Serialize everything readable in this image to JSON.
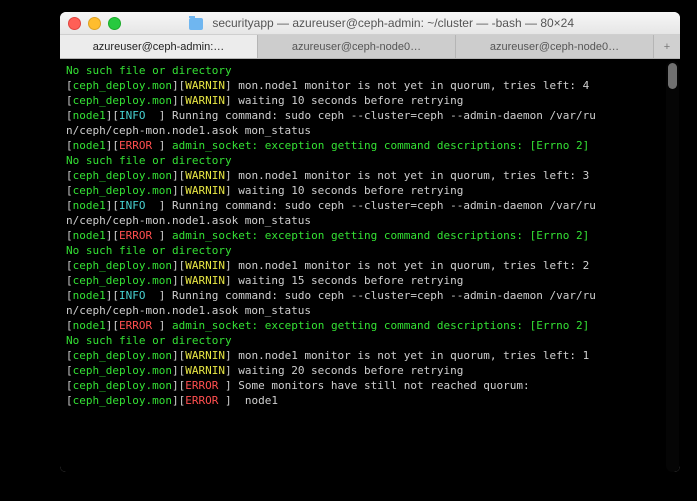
{
  "window": {
    "title": "securityapp — azureuser@ceph-admin: ~/cluster — -bash — 80×24"
  },
  "tabs": {
    "items": [
      {
        "label": "azureuser@ceph-admin:…",
        "active": true
      },
      {
        "label": "azureuser@ceph-node0…",
        "active": false
      },
      {
        "label": "azureuser@ceph-node0…",
        "active": false
      }
    ],
    "add": "+"
  },
  "term": {
    "lines": [
      [
        {
          "c": "g",
          "t": "No such file or directory"
        }
      ],
      [
        {
          "c": "w",
          "t": "["
        },
        {
          "c": "g",
          "t": "ceph_deploy.mon"
        },
        {
          "c": "w",
          "t": "]["
        },
        {
          "c": "y",
          "t": "WARNIN"
        },
        {
          "c": "w",
          "t": "] mon.node1 monitor is not yet in quorum, tries left: 4"
        }
      ],
      [
        {
          "c": "w",
          "t": "["
        },
        {
          "c": "g",
          "t": "ceph_deploy.mon"
        },
        {
          "c": "w",
          "t": "]["
        },
        {
          "c": "y",
          "t": "WARNIN"
        },
        {
          "c": "w",
          "t": "] waiting 10 seconds before retrying"
        }
      ],
      [
        {
          "c": "w",
          "t": "["
        },
        {
          "c": "g",
          "t": "node1"
        },
        {
          "c": "w",
          "t": "]["
        },
        {
          "c": "c",
          "t": "INFO  "
        },
        {
          "c": "w",
          "t": "] Running command: sudo ceph --cluster=ceph --admin-daemon /var/ru"
        }
      ],
      [
        {
          "c": "w",
          "t": "n/ceph/ceph-mon.node1.asok mon_status"
        }
      ],
      [
        {
          "c": "w",
          "t": "["
        },
        {
          "c": "g",
          "t": "node1"
        },
        {
          "c": "w",
          "t": "]["
        },
        {
          "c": "r",
          "t": "ERROR "
        },
        {
          "c": "w",
          "t": "] "
        },
        {
          "c": "g",
          "t": "admin_socket: exception getting command descriptions: [Errno 2] "
        }
      ],
      [
        {
          "c": "g",
          "t": "No such file or directory"
        }
      ],
      [
        {
          "c": "w",
          "t": "["
        },
        {
          "c": "g",
          "t": "ceph_deploy.mon"
        },
        {
          "c": "w",
          "t": "]["
        },
        {
          "c": "y",
          "t": "WARNIN"
        },
        {
          "c": "w",
          "t": "] mon.node1 monitor is not yet in quorum, tries left: 3"
        }
      ],
      [
        {
          "c": "w",
          "t": "["
        },
        {
          "c": "g",
          "t": "ceph_deploy.mon"
        },
        {
          "c": "w",
          "t": "]["
        },
        {
          "c": "y",
          "t": "WARNIN"
        },
        {
          "c": "w",
          "t": "] waiting 10 seconds before retrying"
        }
      ],
      [
        {
          "c": "w",
          "t": "["
        },
        {
          "c": "g",
          "t": "node1"
        },
        {
          "c": "w",
          "t": "]["
        },
        {
          "c": "c",
          "t": "INFO  "
        },
        {
          "c": "w",
          "t": "] Running command: sudo ceph --cluster=ceph --admin-daemon /var/ru"
        }
      ],
      [
        {
          "c": "w",
          "t": "n/ceph/ceph-mon.node1.asok mon_status"
        }
      ],
      [
        {
          "c": "w",
          "t": "["
        },
        {
          "c": "g",
          "t": "node1"
        },
        {
          "c": "w",
          "t": "]["
        },
        {
          "c": "r",
          "t": "ERROR "
        },
        {
          "c": "w",
          "t": "] "
        },
        {
          "c": "g",
          "t": "admin_socket: exception getting command descriptions: [Errno 2] "
        }
      ],
      [
        {
          "c": "g",
          "t": "No such file or directory"
        }
      ],
      [
        {
          "c": "w",
          "t": "["
        },
        {
          "c": "g",
          "t": "ceph_deploy.mon"
        },
        {
          "c": "w",
          "t": "]["
        },
        {
          "c": "y",
          "t": "WARNIN"
        },
        {
          "c": "w",
          "t": "] mon.node1 monitor is not yet in quorum, tries left: 2"
        }
      ],
      [
        {
          "c": "w",
          "t": "["
        },
        {
          "c": "g",
          "t": "ceph_deploy.mon"
        },
        {
          "c": "w",
          "t": "]["
        },
        {
          "c": "y",
          "t": "WARNIN"
        },
        {
          "c": "w",
          "t": "] waiting 15 seconds before retrying"
        }
      ],
      [
        {
          "c": "w",
          "t": "["
        },
        {
          "c": "g",
          "t": "node1"
        },
        {
          "c": "w",
          "t": "]["
        },
        {
          "c": "c",
          "t": "INFO  "
        },
        {
          "c": "w",
          "t": "] Running command: sudo ceph --cluster=ceph --admin-daemon /var/ru"
        }
      ],
      [
        {
          "c": "w",
          "t": "n/ceph/ceph-mon.node1.asok mon_status"
        }
      ],
      [
        {
          "c": "w",
          "t": "["
        },
        {
          "c": "g",
          "t": "node1"
        },
        {
          "c": "w",
          "t": "]["
        },
        {
          "c": "r",
          "t": "ERROR "
        },
        {
          "c": "w",
          "t": "] "
        },
        {
          "c": "g",
          "t": "admin_socket: exception getting command descriptions: [Errno 2] "
        }
      ],
      [
        {
          "c": "g",
          "t": "No such file or directory"
        }
      ],
      [
        {
          "c": "w",
          "t": "["
        },
        {
          "c": "g",
          "t": "ceph_deploy.mon"
        },
        {
          "c": "w",
          "t": "]["
        },
        {
          "c": "y",
          "t": "WARNIN"
        },
        {
          "c": "w",
          "t": "] mon.node1 monitor is not yet in quorum, tries left: 1"
        }
      ],
      [
        {
          "c": "w",
          "t": "["
        },
        {
          "c": "g",
          "t": "ceph_deploy.mon"
        },
        {
          "c": "w",
          "t": "]["
        },
        {
          "c": "y",
          "t": "WARNIN"
        },
        {
          "c": "w",
          "t": "] waiting 20 seconds before retrying"
        }
      ],
      [
        {
          "c": "w",
          "t": "["
        },
        {
          "c": "g",
          "t": "ceph_deploy.mon"
        },
        {
          "c": "w",
          "t": "]["
        },
        {
          "c": "r",
          "t": "ERROR "
        },
        {
          "c": "w",
          "t": "] Some monitors have still not reached quorum:"
        }
      ],
      [
        {
          "c": "w",
          "t": "["
        },
        {
          "c": "g",
          "t": "ceph_deploy.mon"
        },
        {
          "c": "w",
          "t": "]["
        },
        {
          "c": "r",
          "t": "ERROR "
        },
        {
          "c": "w",
          "t": "]  node1"
        }
      ]
    ]
  }
}
